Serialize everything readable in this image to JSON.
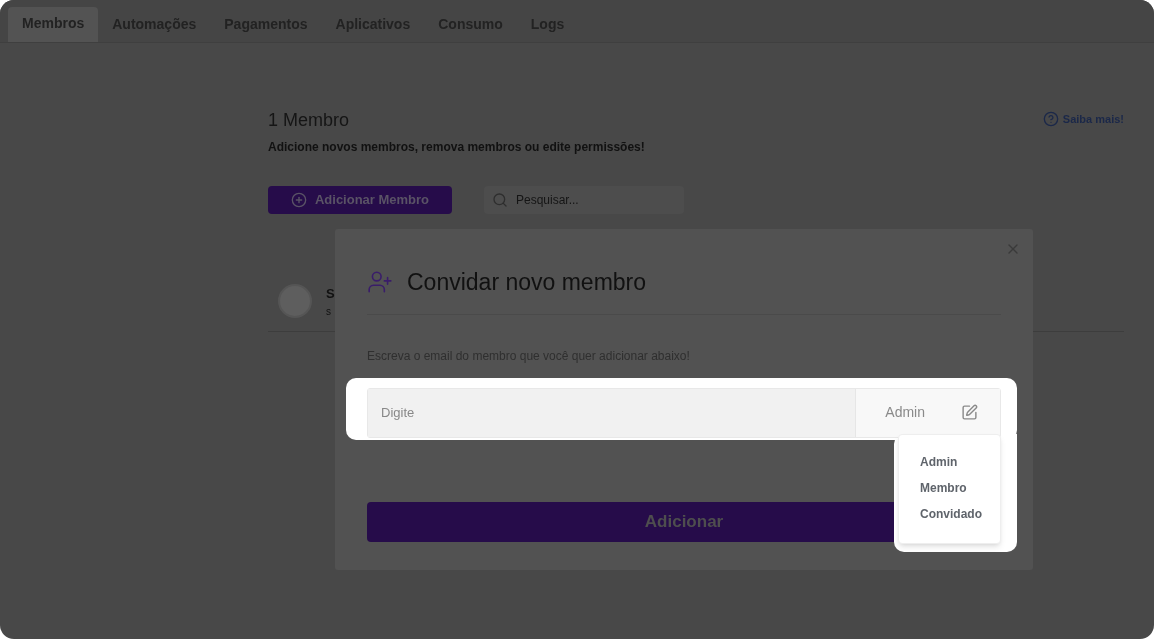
{
  "tabs": [
    {
      "label": "Membros",
      "selected": true
    },
    {
      "label": "Automações",
      "selected": false
    },
    {
      "label": "Pagamentos",
      "selected": false
    },
    {
      "label": "Aplicativos",
      "selected": false
    },
    {
      "label": "Consumo",
      "selected": false
    },
    {
      "label": "Logs",
      "selected": false
    }
  ],
  "header": {
    "title": "1 Membro",
    "subtitle": "Adicione novos membros, remova membros ou edite permissões!",
    "help_link": "Saiba mais!"
  },
  "toolbar": {
    "add_button": "Adicionar Membro",
    "search": {
      "placeholder": "Pesquisar..."
    }
  },
  "members": [
    {
      "name": "S",
      "email": "s"
    }
  ],
  "modal": {
    "title": "Convidar novo membro",
    "instruction": "Escreva o email do membro que você quer adicionar abaixo!",
    "email_field": {
      "placeholder": "Digite"
    },
    "role": "Admin",
    "role_menu": [
      "Admin",
      "Membro",
      "Convidado"
    ],
    "submit": "Adicionar"
  }
}
